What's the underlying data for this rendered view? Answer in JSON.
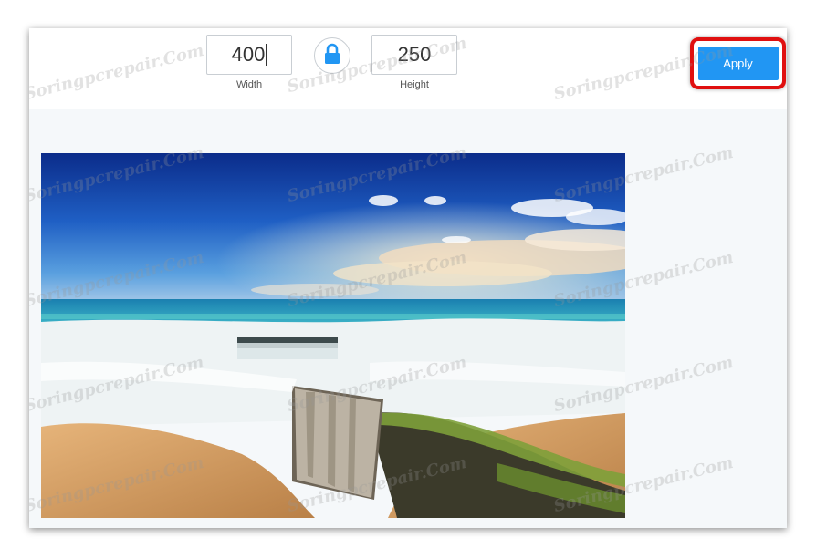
{
  "dimensions": {
    "width_value": "400",
    "width_label": "Width",
    "height_value": "250",
    "height_label": "Height",
    "aspect_lock": "locked"
  },
  "apply": {
    "label": "Apply"
  },
  "watermark": "Soringpcrepair.Com",
  "colors": {
    "accent": "#2196f3",
    "highlight": "#e01010",
    "lock_icon": "#2196f3"
  },
  "icons": {
    "lock": "lock-icon"
  }
}
